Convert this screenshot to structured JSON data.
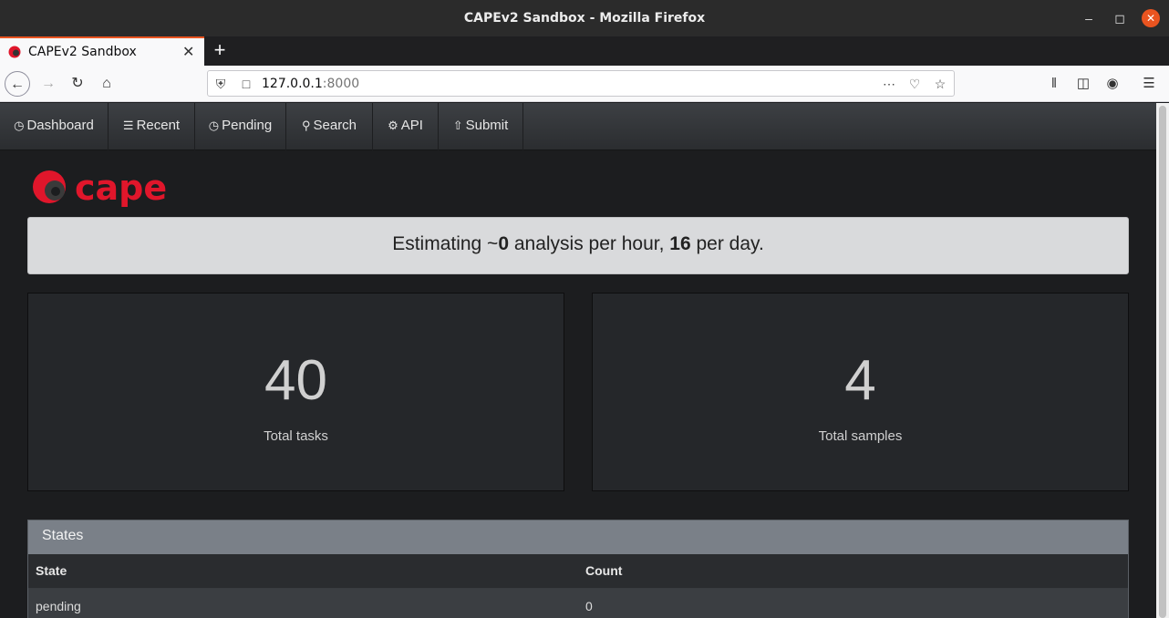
{
  "window": {
    "title": "CAPEv2 Sandbox - Mozilla Firefox",
    "minimize_icon": "minimize-icon",
    "maximize_icon": "maximize-icon",
    "close_icon": "close-icon"
  },
  "browser": {
    "tab_title": "CAPEv2 Sandbox",
    "url_host": "127.0.0.1",
    "url_port": ":8000"
  },
  "appnav": {
    "items": [
      {
        "label": "Dashboard",
        "icon": "dashboard-icon"
      },
      {
        "label": "Recent",
        "icon": "list-icon"
      },
      {
        "label": "Pending",
        "icon": "clock-icon"
      },
      {
        "label": "Search",
        "icon": "search-icon"
      },
      {
        "label": "API",
        "icon": "gear-icon"
      },
      {
        "label": "Submit",
        "icon": "upload-icon"
      }
    ]
  },
  "logo": {
    "text": "cape",
    "color": "#e0162b"
  },
  "banner": {
    "prefix": "Estimating ~",
    "per_hour": "0",
    "mid": " analysis per hour, ",
    "per_day": "16",
    "suffix": " per day."
  },
  "stats": {
    "tasks": {
      "value": "40",
      "label": "Total tasks"
    },
    "samples": {
      "value": "4",
      "label": "Total samples"
    }
  },
  "states": {
    "title": "States",
    "columns": [
      "State",
      "Count"
    ],
    "rows": [
      {
        "state": "pending",
        "count": "0"
      }
    ]
  },
  "colors": {
    "accent": "#e95420",
    "brand_red": "#e0162b",
    "page_bg": "#1c1d1f"
  }
}
